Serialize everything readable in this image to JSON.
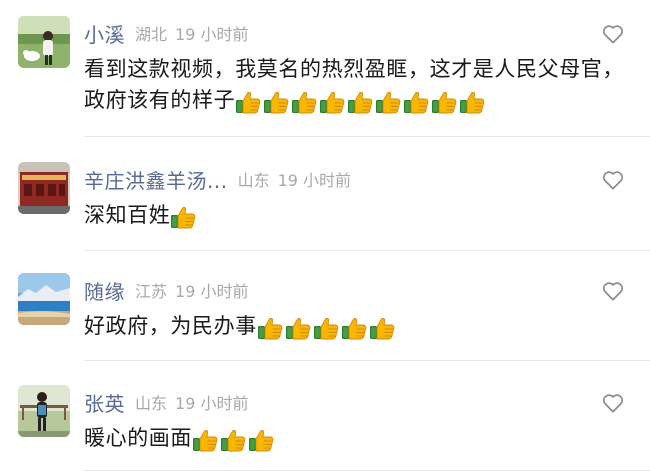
{
  "comments": [
    {
      "name": "小溪",
      "location": "湖北",
      "time": "19 小时前",
      "text": "看到这款视频，我莫名的热烈盈眶，这才是人民父母官，政府该有的样子",
      "thumbs_count": 9,
      "avatar": "avatar-person-outdoor"
    },
    {
      "name": "辛庄洪鑫羊汤...",
      "location": "山东",
      "time": "19 小时前",
      "text": "深知百姓",
      "thumbs_count": 1,
      "avatar": "avatar-storefront"
    },
    {
      "name": "随缘",
      "location": "江苏",
      "time": "19 小时前",
      "text": "好政府，为民办事",
      "thumbs_count": 5,
      "avatar": "avatar-lake-landscape"
    },
    {
      "name": "张英",
      "location": "山东",
      "time": "19 小时前",
      "text": "暖心的画面",
      "thumbs_count": 3,
      "avatar": "avatar-person-garden"
    }
  ],
  "icons": {
    "like": "heart-outline-icon",
    "reaction": "thumbs-up-emoji"
  },
  "colors": {
    "name": "#586b95",
    "meta": "#a8a8a8",
    "text": "#1a1a1a",
    "divider": "#e8e8e8",
    "heart": "#8a8a8a"
  }
}
